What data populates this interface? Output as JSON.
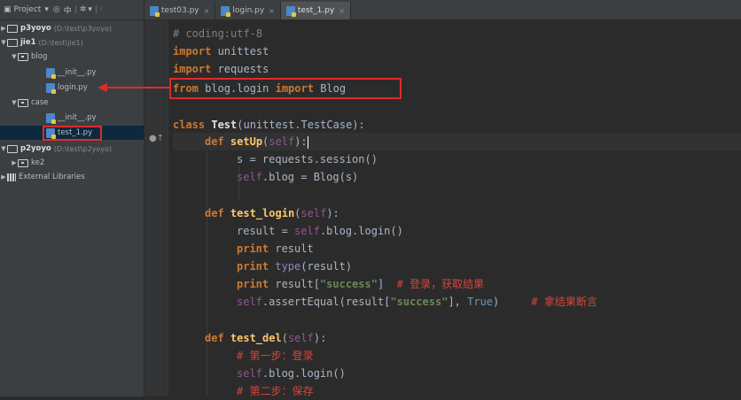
{
  "project_panel": {
    "toolbar": {
      "title": "Project",
      "icons": [
        "dropdown-icon",
        "target-icon",
        "split-icon",
        "gear-icon",
        "collapse-icon"
      ]
    },
    "tree": [
      {
        "name": "p3yoyo",
        "path": "(D:\\test\\p3yoyo)",
        "type": "project-folder",
        "expanded": false
      },
      {
        "name": "jie1",
        "path": "(D:\\test\\jie1)",
        "type": "project-folder",
        "expanded": true
      },
      {
        "name": "blog",
        "type": "package",
        "expanded": true
      },
      {
        "name": "__init__.py",
        "type": "python-file"
      },
      {
        "name": "login.py",
        "type": "python-file"
      },
      {
        "name": "case",
        "type": "package",
        "expanded": true
      },
      {
        "name": "__init__.py",
        "type": "python-file"
      },
      {
        "name": "test_1.py",
        "type": "python-file",
        "selected": true
      },
      {
        "name": "p2yoyo",
        "path": "(D:\\test\\p2yoyo)",
        "type": "project-folder",
        "expanded": true
      },
      {
        "name": "ke2",
        "type": "package",
        "expanded": false
      },
      {
        "name": "External Libraries",
        "type": "libraries",
        "expanded": false
      }
    ]
  },
  "tabs": [
    {
      "label": "test03.py",
      "active": false
    },
    {
      "label": "login.py",
      "active": false
    },
    {
      "label": "test_1.py",
      "active": true
    }
  ],
  "code": {
    "l1": "# coding:utf-8",
    "l2_kw": "import",
    "l2_mod": " unittest",
    "l3_kw": "import",
    "l3_mod": " requests",
    "l4_kw1": "from",
    "l4_mod": " blog.login ",
    "l4_kw2": "import",
    "l4_name": " Blog",
    "l6_kw": "class",
    "l6_name": "Test",
    "l6_rest": "(unittest.TestCase):",
    "l7_kw": "def",
    "l7_name": "setUp",
    "l7_p1": "(",
    "l7_self": "self",
    "l7_p2": "):",
    "l8": "s = requests.session()",
    "l9_self": "self",
    "l9_rest": ".blog = Blog(s)",
    "l11_kw": "def",
    "l11_name": "test_login",
    "l11_p1": "(",
    "l11_self": "self",
    "l11_p2": "):",
    "l12_a": "result = ",
    "l12_self": "self",
    "l12_b": ".blog.login()",
    "l13_kw": "print",
    "l13_rest": " result",
    "l14_kw": "print",
    "l14_bi": " type",
    "l14_rest": "(result)",
    "l15_kw": "print",
    "l15_a": " result[",
    "l15_str": "\"success\"",
    "l15_b": "]  ",
    "l15_cm": "# 登录，获取结果",
    "l16_self": "self",
    "l16_a": ".assertEqual(result[",
    "l16_str": "\"success\"",
    "l16_b": "], ",
    "l16_true": "True",
    "l16_c": ")     ",
    "l16_cm": "# 拿结果断言",
    "l18_kw": "def",
    "l18_name": "test_del",
    "l18_p1": "(",
    "l18_self": "self",
    "l18_p2": "):",
    "l19_cm": "# 第一步：登录",
    "l20_self": "self",
    "l20_rest": ".blog.login()",
    "l21_cm": "# 第二步：保存"
  },
  "colors": {
    "annotation_red": "#e02a2a",
    "selection": "#0d293e",
    "editor_bg": "#2b2b2b"
  }
}
